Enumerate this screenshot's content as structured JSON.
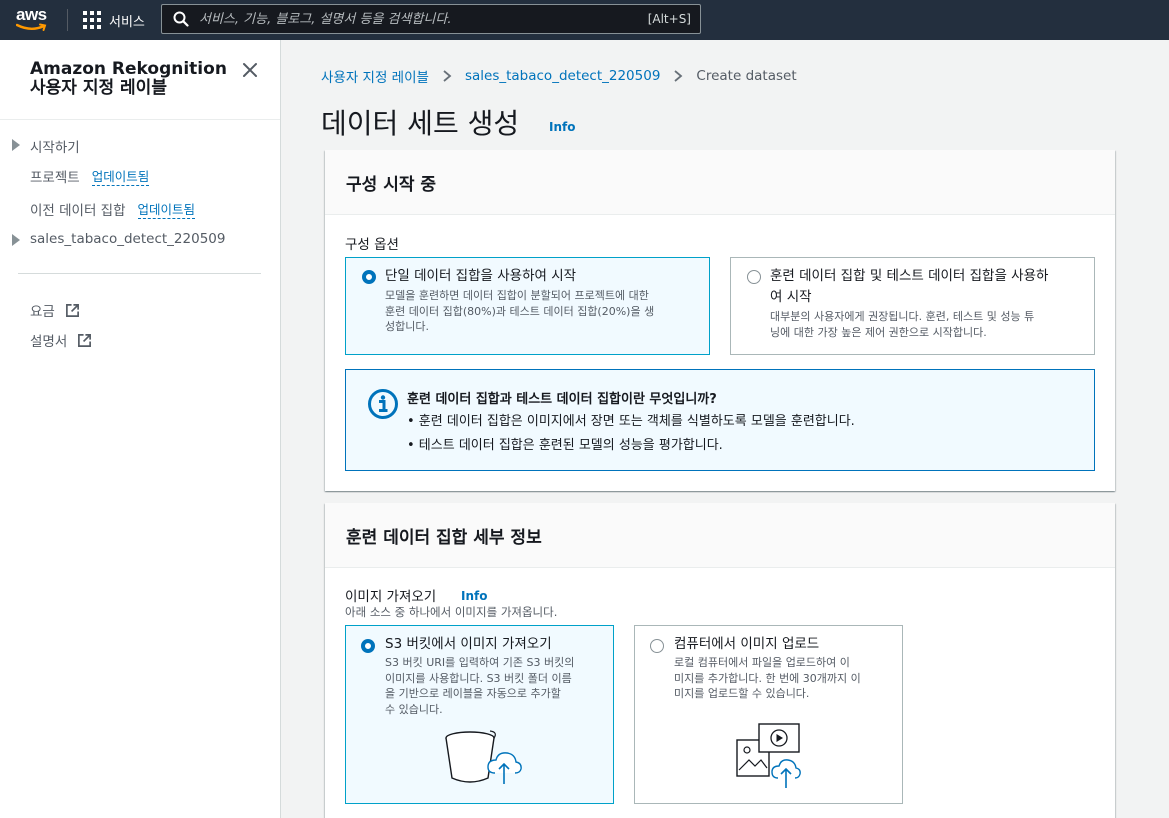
{
  "topbar": {
    "logo_text": "aws",
    "services_label": "서비스",
    "search_placeholder": "서비스, 기능, 블로그, 설명서 등을 검색합니다.",
    "search_shortcut": "[Alt+S]"
  },
  "sidebar": {
    "title_line1": "Amazon Rekognition",
    "title_line2": "사용자 지정 레이블",
    "items": [
      {
        "label": "시작하기"
      },
      {
        "label": "프로젝트",
        "badge": "업데이트됨"
      },
      {
        "label": "이전 데이터 집합",
        "badge": "업데이트됨"
      },
      {
        "label": "sales_tabaco_detect_220509"
      }
    ],
    "links": [
      {
        "label": "요금"
      },
      {
        "label": "설명서"
      }
    ]
  },
  "breadcrumb": {
    "items": [
      "사용자 지정 레이블",
      "sales_tabaco_detect_220509",
      "Create dataset"
    ]
  },
  "page": {
    "title": "데이터 세트 생성",
    "info": "Info"
  },
  "config": {
    "header": "구성 시작 중",
    "options_label": "구성 옵션",
    "option1": {
      "title": "단일 데이터 집합을 사용하여 시작",
      "desc_lines": [
        "모델을 훈련하면 데이터 집합이 분할되어 프로젝트에 대한",
        "훈련 데이터 집합(80%)과 테스트 데이터 집합(20%)을 생",
        "성합니다."
      ],
      "selected": true
    },
    "option2": {
      "title_lines": [
        "훈련 데이터 집합 및 테스트 데이터 집합을 사용하",
        "여 시작"
      ],
      "desc_lines": [
        "대부분의 사용자에게 권장됩니다. 훈련, 테스트 및 성능 튜",
        "닝에 대한 가장 높은 제어 권한으로 시작합니다."
      ],
      "selected": false
    },
    "alert": {
      "title": "훈련 데이터 집합과 테스트 데이터 집합이란 무엇입니까?",
      "items": [
        "• 훈련 데이터 집합은 이미지에서 장면 또는 객체를 식별하도록 모델을 훈련합니다.",
        "• 테스트 데이터 집합은 훈련된 모델의 성능을 평가합니다."
      ]
    }
  },
  "training": {
    "header": "훈련 데이터 집합 세부 정보",
    "import_label": "이미지 가져오기",
    "info": "Info",
    "import_desc": "아래 소스 중 하나에서 이미지를 가져옵니다.",
    "option1": {
      "title": "S3 버킷에서 이미지 가져오기",
      "desc_lines": [
        "S3 버킷 URI를 입력하여 기존 S3 버킷의",
        "이미지를 사용합니다. S3 버킷 폴더 이름",
        "을 기반으로 레이블을 자동으로 추가할",
        "수 있습니다."
      ],
      "selected": true
    },
    "option2": {
      "title": "컴퓨터에서 이미지 업로드",
      "desc_lines": [
        "로컬 컴퓨터에서 파일을 업로드하여 이",
        "미지를 추가합니다. 한 번에 30개까지 이",
        "미지를 업로드할 수 있습니다."
      ],
      "selected": false
    }
  },
  "icons": {
    "search": "search-icon",
    "services": "grid-icon",
    "close": "close-icon",
    "external": "external-link-icon",
    "chevron": "chevron-right-icon",
    "info": "info-circle-icon",
    "bucket": "s3-bucket-upload-icon",
    "computer": "computer-upload-icon"
  },
  "colors": {
    "nav_bg": "#232f3e",
    "link": "#0073bb",
    "selected_border": "#00a1c9",
    "selected_bg": "#f1faff"
  }
}
